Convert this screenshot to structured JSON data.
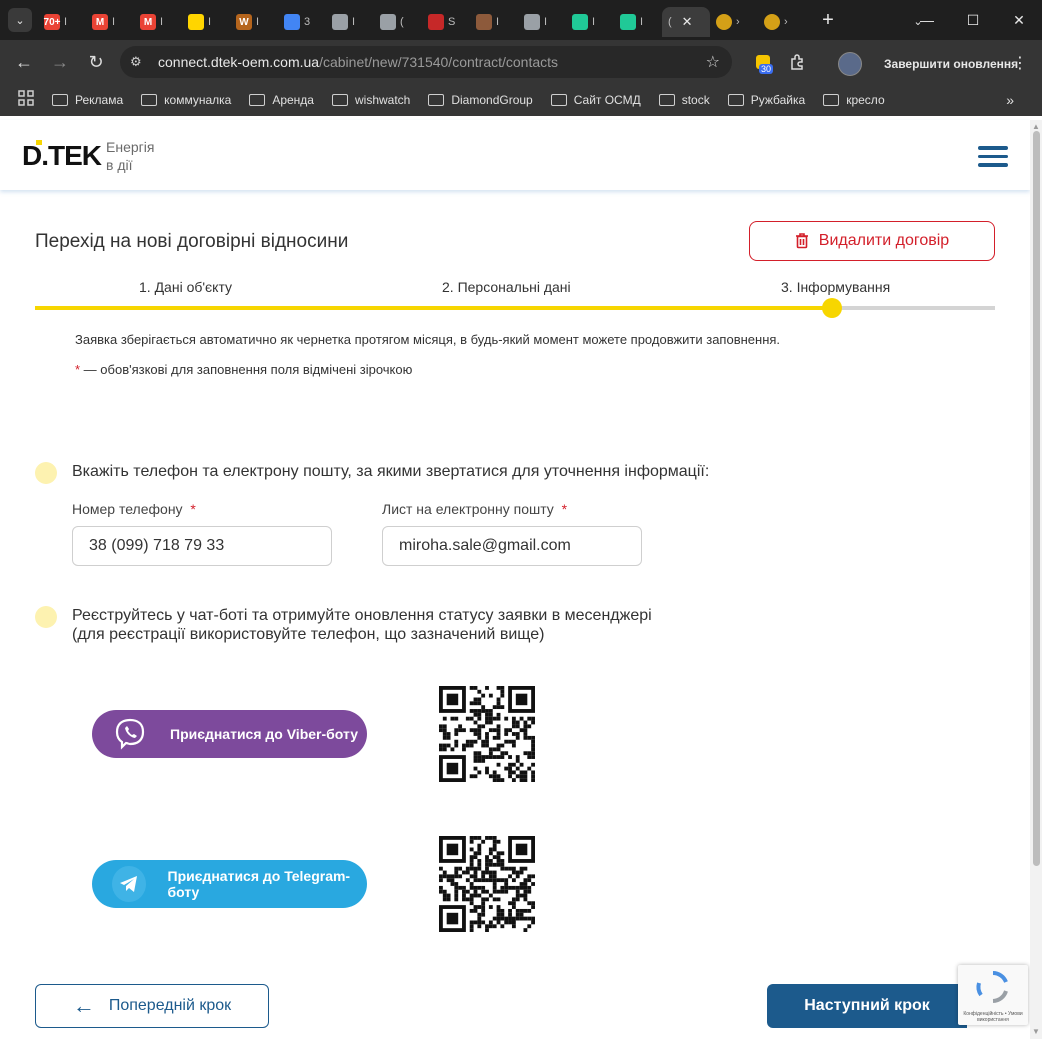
{
  "browser": {
    "tab_menu_icon": "chevron-down-icon",
    "tabs": [
      {
        "badge": "70+",
        "color": "#ea4335",
        "mini": "I"
      },
      {
        "badge": "M",
        "color": "#ea4335",
        "mini": "I"
      },
      {
        "badge": "M",
        "color": "#ea4335",
        "mini": "I"
      },
      {
        "badge": "",
        "color": "#ffd500",
        "mini": "I"
      },
      {
        "badge": "W",
        "color": "#b5651d",
        "mini": "I"
      },
      {
        "badge": "",
        "color": "#4285f4",
        "mini": "3"
      },
      {
        "badge": "",
        "color": "#9aa0a6",
        "mini": "I"
      },
      {
        "badge": "",
        "color": "#9aa0a6",
        "mini": "("
      },
      {
        "badge": "",
        "color": "#c62828",
        "mini": "S"
      },
      {
        "badge": "",
        "color": "#8d5a3b",
        "mini": "I"
      },
      {
        "badge": "",
        "color": "#9aa0a6",
        "mini": "I"
      },
      {
        "badge": "",
        "color": "#20c997",
        "mini": "I"
      },
      {
        "badge": "",
        "color": "#20c997",
        "mini": "I"
      }
    ],
    "active_tab_mini": "(",
    "url_host": "connect.dtek-oem.com.ua",
    "url_path": "/cabinet/new/731540/contract/contacts",
    "extension_badge": "30",
    "update_label": "Завершити оновлення",
    "bookmarks": [
      "Реклама",
      "коммуналка",
      "Аренда",
      "wishwatch",
      "DiamondGroup",
      "Сайт ОСМД",
      "stock",
      "Ружбайка",
      "кресло"
    ]
  },
  "site": {
    "logo_text": "D.TEK",
    "tagline_line1": "Енергія",
    "tagline_line2": "в дії",
    "brand_color": "#1c5a8c",
    "accent_color": "#f7d600"
  },
  "page": {
    "title": "Перехід на нові договірні відносини",
    "delete_label": "Видалити договір",
    "steps": [
      "1. Дані об'єкту",
      "2. Персональні дані",
      "3. Інформування"
    ],
    "progress_percent": 83,
    "note_autosave": "Заявка зберігається автоматично як чернетка протягом місяця, в будь-який момент можете продовжити заповнення.",
    "note_required_star": "*",
    "note_required": " — обов'язкові для заповнення поля відмічені зірочкою",
    "contact_question": "Вкажіть телефон та електрону пошту, за якими звертатися для уточнення інформації:",
    "phone_label": "Номер телефону",
    "phone_value": "38 (099) 718 79 33",
    "email_label": "Лист на електронну пошту",
    "email_value": "miroha.sale@gmail.com",
    "required_mark": "*",
    "bot_line1": "Реєструйтесь у чат-боті та отримуйте оновлення статусу заявки в месенджері",
    "bot_line2": "(для реєстрації використовуйте телефон, що зазначений вище)",
    "viber_label": "Приєднатися до Viber-боту",
    "telegram_label": "Приєднатися до Telegram-боту",
    "prev_label": "Попередній крок",
    "next_label": "Наступний крок",
    "recaptcha_text": "Конфіденційність • Умови використання"
  }
}
